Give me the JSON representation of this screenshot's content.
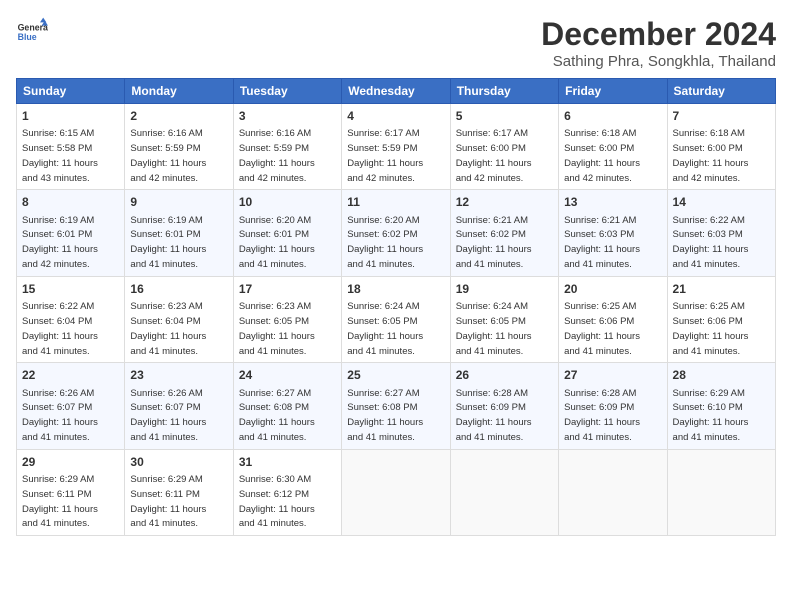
{
  "header": {
    "logo_line1": "General",
    "logo_line2": "Blue",
    "title": "December 2024",
    "subtitle": "Sathing Phra, Songkhla, Thailand"
  },
  "weekdays": [
    "Sunday",
    "Monday",
    "Tuesday",
    "Wednesday",
    "Thursday",
    "Friday",
    "Saturday"
  ],
  "weeks": [
    [
      {
        "day": "1",
        "sunrise": "6:15 AM",
        "sunset": "5:58 PM",
        "daylight": "11 hours and 43 minutes."
      },
      {
        "day": "2",
        "sunrise": "6:16 AM",
        "sunset": "5:59 PM",
        "daylight": "11 hours and 42 minutes."
      },
      {
        "day": "3",
        "sunrise": "6:16 AM",
        "sunset": "5:59 PM",
        "daylight": "11 hours and 42 minutes."
      },
      {
        "day": "4",
        "sunrise": "6:17 AM",
        "sunset": "5:59 PM",
        "daylight": "11 hours and 42 minutes."
      },
      {
        "day": "5",
        "sunrise": "6:17 AM",
        "sunset": "6:00 PM",
        "daylight": "11 hours and 42 minutes."
      },
      {
        "day": "6",
        "sunrise": "6:18 AM",
        "sunset": "6:00 PM",
        "daylight": "11 hours and 42 minutes."
      },
      {
        "day": "7",
        "sunrise": "6:18 AM",
        "sunset": "6:00 PM",
        "daylight": "11 hours and 42 minutes."
      }
    ],
    [
      {
        "day": "8",
        "sunrise": "6:19 AM",
        "sunset": "6:01 PM",
        "daylight": "11 hours and 42 minutes."
      },
      {
        "day": "9",
        "sunrise": "6:19 AM",
        "sunset": "6:01 PM",
        "daylight": "11 hours and 41 minutes."
      },
      {
        "day": "10",
        "sunrise": "6:20 AM",
        "sunset": "6:01 PM",
        "daylight": "11 hours and 41 minutes."
      },
      {
        "day": "11",
        "sunrise": "6:20 AM",
        "sunset": "6:02 PM",
        "daylight": "11 hours and 41 minutes."
      },
      {
        "day": "12",
        "sunrise": "6:21 AM",
        "sunset": "6:02 PM",
        "daylight": "11 hours and 41 minutes."
      },
      {
        "day": "13",
        "sunrise": "6:21 AM",
        "sunset": "6:03 PM",
        "daylight": "11 hours and 41 minutes."
      },
      {
        "day": "14",
        "sunrise": "6:22 AM",
        "sunset": "6:03 PM",
        "daylight": "11 hours and 41 minutes."
      }
    ],
    [
      {
        "day": "15",
        "sunrise": "6:22 AM",
        "sunset": "6:04 PM",
        "daylight": "11 hours and 41 minutes."
      },
      {
        "day": "16",
        "sunrise": "6:23 AM",
        "sunset": "6:04 PM",
        "daylight": "11 hours and 41 minutes."
      },
      {
        "day": "17",
        "sunrise": "6:23 AM",
        "sunset": "6:05 PM",
        "daylight": "11 hours and 41 minutes."
      },
      {
        "day": "18",
        "sunrise": "6:24 AM",
        "sunset": "6:05 PM",
        "daylight": "11 hours and 41 minutes."
      },
      {
        "day": "19",
        "sunrise": "6:24 AM",
        "sunset": "6:05 PM",
        "daylight": "11 hours and 41 minutes."
      },
      {
        "day": "20",
        "sunrise": "6:25 AM",
        "sunset": "6:06 PM",
        "daylight": "11 hours and 41 minutes."
      },
      {
        "day": "21",
        "sunrise": "6:25 AM",
        "sunset": "6:06 PM",
        "daylight": "11 hours and 41 minutes."
      }
    ],
    [
      {
        "day": "22",
        "sunrise": "6:26 AM",
        "sunset": "6:07 PM",
        "daylight": "11 hours and 41 minutes."
      },
      {
        "day": "23",
        "sunrise": "6:26 AM",
        "sunset": "6:07 PM",
        "daylight": "11 hours and 41 minutes."
      },
      {
        "day": "24",
        "sunrise": "6:27 AM",
        "sunset": "6:08 PM",
        "daylight": "11 hours and 41 minutes."
      },
      {
        "day": "25",
        "sunrise": "6:27 AM",
        "sunset": "6:08 PM",
        "daylight": "11 hours and 41 minutes."
      },
      {
        "day": "26",
        "sunrise": "6:28 AM",
        "sunset": "6:09 PM",
        "daylight": "11 hours and 41 minutes."
      },
      {
        "day": "27",
        "sunrise": "6:28 AM",
        "sunset": "6:09 PM",
        "daylight": "11 hours and 41 minutes."
      },
      {
        "day": "28",
        "sunrise": "6:29 AM",
        "sunset": "6:10 PM",
        "daylight": "11 hours and 41 minutes."
      }
    ],
    [
      {
        "day": "29",
        "sunrise": "6:29 AM",
        "sunset": "6:11 PM",
        "daylight": "11 hours and 41 minutes."
      },
      {
        "day": "30",
        "sunrise": "6:29 AM",
        "sunset": "6:11 PM",
        "daylight": "11 hours and 41 minutes."
      },
      {
        "day": "31",
        "sunrise": "6:30 AM",
        "sunset": "6:12 PM",
        "daylight": "11 hours and 41 minutes."
      },
      null,
      null,
      null,
      null
    ]
  ]
}
